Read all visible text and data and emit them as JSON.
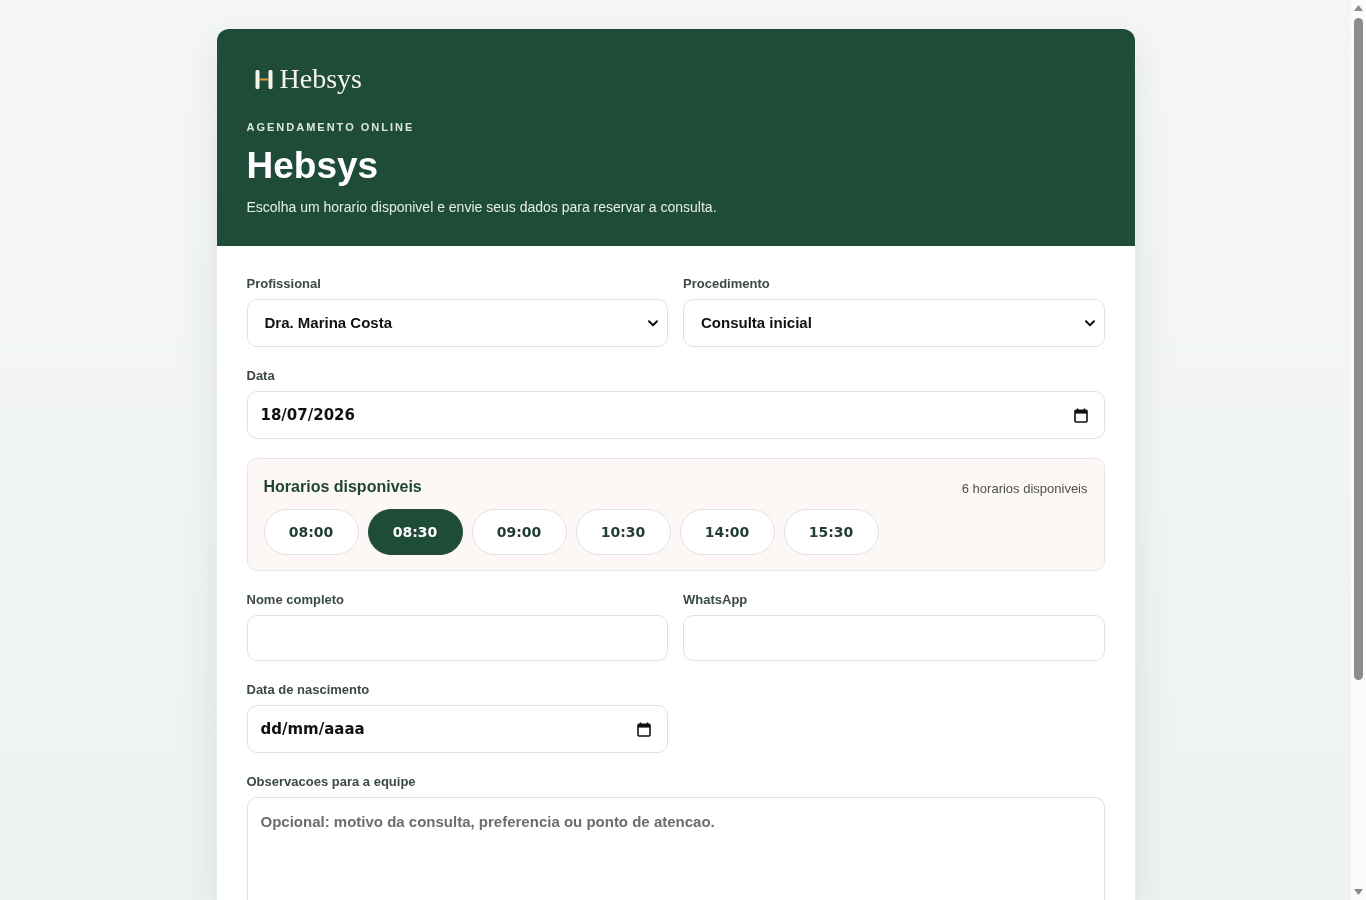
{
  "header": {
    "logo": "Hebsys",
    "eyebrow": "AGENDAMENTO ONLINE",
    "title": "Hebsys",
    "subtitle": "Escolha um horario disponivel e envie seus dados para reservar a consulta."
  },
  "professional": {
    "label": "Profissional",
    "value": "Dra. Marina Costa"
  },
  "procedure": {
    "label": "Procedimento",
    "value": "Consulta inicial"
  },
  "date": {
    "label": "Data",
    "value": "18/07/2026"
  },
  "slots": {
    "title": "Horarios disponiveis",
    "count": "6 horarios disponiveis",
    "times": [
      {
        "label": "08:00",
        "selected": false
      },
      {
        "label": "08:30",
        "selected": true
      },
      {
        "label": "09:00",
        "selected": false
      },
      {
        "label": "10:30",
        "selected": false
      },
      {
        "label": "14:00",
        "selected": false
      },
      {
        "label": "15:30",
        "selected": false
      }
    ]
  },
  "full_name": {
    "label": "Nome completo"
  },
  "whatsapp": {
    "label": "WhatsApp"
  },
  "birth_date": {
    "label": "Data de nascimento",
    "placeholder": "dd/mm/aaaa"
  },
  "notes": {
    "label": "Observacoes para a equipe",
    "placeholder": "Opcional: motivo da consulta, preferencia ou ponto de atencao."
  }
}
